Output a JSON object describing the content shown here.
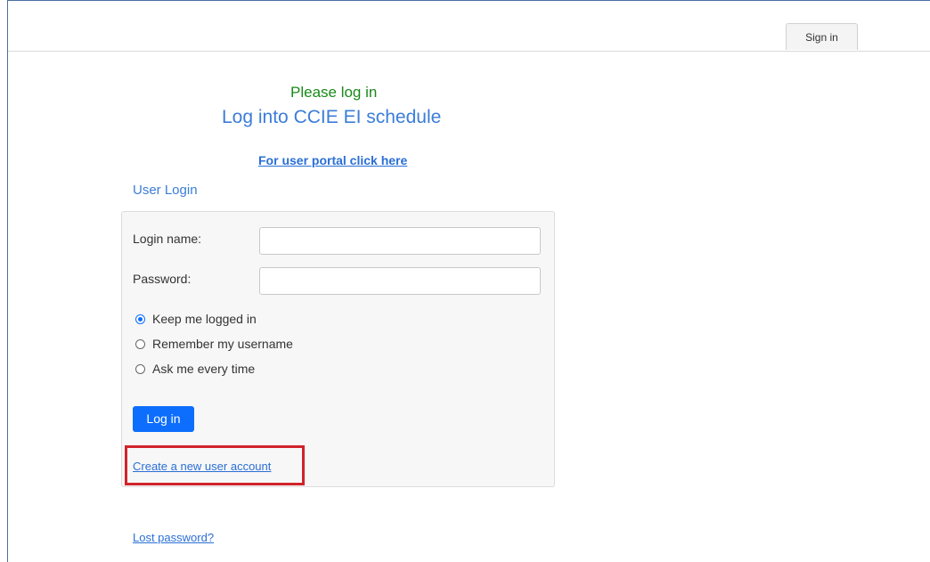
{
  "header": {
    "signin_label": "Sign in"
  },
  "main": {
    "please_text": "Please log in",
    "title": "Log into CCIE EI schedule",
    "portal_link": "For user portal click here",
    "section_label": "User Login"
  },
  "form": {
    "login_label": "Login name:",
    "login_value": "",
    "password_label": "Password:",
    "password_value": "",
    "options": [
      {
        "label": "Keep me logged in",
        "checked": true
      },
      {
        "label": "Remember my username",
        "checked": false
      },
      {
        "label": "Ask me every time",
        "checked": false
      }
    ],
    "login_button": "Log in",
    "create_account": "Create a new user account"
  },
  "footer": {
    "lost_password": "Lost password?"
  },
  "colors": {
    "accent_green": "#1a8a1a",
    "accent_blue": "#3b7dd8",
    "button_blue": "#0d6efd",
    "highlight_red": "#d1232a"
  }
}
